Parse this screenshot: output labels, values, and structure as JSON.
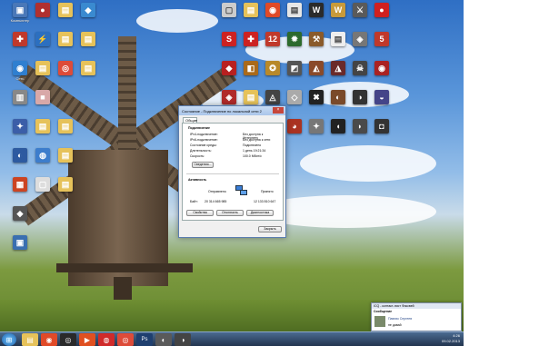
{
  "desktop": {
    "icons": [
      {
        "label": "Компьютер",
        "color": "#4a78b8",
        "glyph": "▣",
        "col": 0,
        "row": 0,
        "icon": "computer-icon"
      },
      {
        "label": "",
        "color": "#b03030",
        "glyph": "●",
        "col": 1,
        "row": 0,
        "icon": "app-icon"
      },
      {
        "label": "",
        "color": "#e6c25a",
        "glyph": "▤",
        "col": 2,
        "row": 0,
        "icon": "folder-icon"
      },
      {
        "label": "",
        "color": "#3a8ad0",
        "glyph": "◆",
        "col": 3,
        "row": 0,
        "icon": "app-icon"
      },
      {
        "label": "",
        "color": "#c0392b",
        "glyph": "✚",
        "col": 0,
        "row": 1,
        "icon": "app-icon"
      },
      {
        "label": "",
        "color": "#2c6fbf",
        "glyph": "⚡",
        "col": 1,
        "row": 1,
        "icon": "app-icon"
      },
      {
        "label": "",
        "color": "#e6c25a",
        "glyph": "▤",
        "col": 2,
        "row": 1,
        "icon": "folder-icon"
      },
      {
        "label": "",
        "color": "#e6c25a",
        "glyph": "▤",
        "col": 3,
        "row": 1,
        "icon": "folder-icon"
      },
      {
        "label": "Сеть",
        "color": "#2f7fd0",
        "glyph": "◉",
        "col": 0,
        "row": 2,
        "icon": "network-icon"
      },
      {
        "label": "",
        "color": "#e6c25a",
        "glyph": "▤",
        "col": 1,
        "row": 2,
        "icon": "folder-icon"
      },
      {
        "label": "",
        "color": "#dd4b39",
        "glyph": "◎",
        "col": 2,
        "row": 2,
        "icon": "chrome-icon"
      },
      {
        "label": "",
        "color": "#e6c25a",
        "glyph": "▤",
        "col": 3,
        "row": 2,
        "icon": "folder-icon"
      },
      {
        "label": "",
        "color": "#888888",
        "glyph": "▥",
        "col": 0,
        "row": 3,
        "icon": "recycle-bin-icon"
      },
      {
        "label": "",
        "color": "#d8a8a8",
        "glyph": "■",
        "col": 1,
        "row": 3,
        "icon": "file-icon"
      },
      {
        "label": "",
        "color": "#3b5ea8",
        "glyph": "✦",
        "col": 0,
        "row": 4,
        "icon": "app-icon"
      },
      {
        "label": "",
        "color": "#e6c25a",
        "glyph": "▤",
        "col": 1,
        "row": 4,
        "icon": "folder-icon"
      },
      {
        "label": "",
        "color": "#e6c25a",
        "glyph": "▤",
        "col": 2,
        "row": 4,
        "icon": "folder-icon"
      },
      {
        "label": "",
        "color": "#2d5aa0",
        "glyph": "◐",
        "col": 0,
        "row": 5,
        "icon": "app-icon"
      },
      {
        "label": "",
        "color": "#3d7dcc",
        "glyph": "◍",
        "col": 1,
        "row": 5,
        "icon": "app-icon"
      },
      {
        "label": "",
        "color": "#e6c25a",
        "glyph": "▤",
        "col": 2,
        "row": 5,
        "icon": "folder-icon"
      },
      {
        "label": "",
        "color": "#cc4422",
        "glyph": "▦",
        "col": 0,
        "row": 6,
        "icon": "app-icon"
      },
      {
        "label": "",
        "color": "#dddddd",
        "glyph": "▢",
        "col": 1,
        "row": 6,
        "icon": "file-icon"
      },
      {
        "label": "",
        "color": "#e6c25a",
        "glyph": "▤",
        "col": 2,
        "row": 6,
        "icon": "folder-icon"
      },
      {
        "label": "",
        "color": "#555555",
        "glyph": "◆",
        "col": 0,
        "row": 7,
        "icon": "app-icon"
      },
      {
        "label": "",
        "color": "#3a6fb0",
        "glyph": "▣",
        "col": 0,
        "row": 8,
        "icon": "app-icon"
      }
    ],
    "right_icons": [
      {
        "color": "#cccccc",
        "glyph": "▢",
        "icon": "file-icon"
      },
      {
        "color": "#e6c25a",
        "glyph": "▤",
        "icon": "folder-icon"
      },
      {
        "color": "#e04a28",
        "glyph": "◉",
        "icon": "firefox-icon"
      },
      {
        "color": "#e6e6e6",
        "glyph": "▤",
        "icon": "file-icon"
      },
      {
        "color": "#2b2b2b",
        "glyph": "W",
        "icon": "game-icon"
      },
      {
        "color": "#c89a3a",
        "glyph": "W",
        "icon": "game-icon"
      },
      {
        "color": "#5a5a5a",
        "glyph": "⚔",
        "icon": "game-icon"
      },
      {
        "color": "#d02020",
        "glyph": "●",
        "icon": "game-icon"
      },
      {
        "color": "#cc2222",
        "glyph": "S",
        "icon": "game-icon"
      },
      {
        "color": "#cc2222",
        "glyph": "✚",
        "icon": "game-icon"
      },
      {
        "color": "#c0392b",
        "glyph": "12",
        "icon": "game-icon"
      },
      {
        "color": "#2d6a2d",
        "glyph": "✹",
        "icon": "game-icon"
      },
      {
        "color": "#8a5a2a",
        "glyph": "⚒",
        "icon": "game-icon"
      },
      {
        "color": "#eeeeee",
        "glyph": "▤",
        "icon": "file-icon"
      },
      {
        "color": "#777777",
        "glyph": "◈",
        "icon": "game-icon"
      },
      {
        "color": "#c0392b",
        "glyph": "5",
        "icon": "game-icon"
      },
      {
        "color": "#b82020",
        "glyph": "◆",
        "icon": "game-icon"
      },
      {
        "color": "#aa6a1a",
        "glyph": "◧",
        "icon": "game-icon"
      },
      {
        "color": "#b8892a",
        "glyph": "✪",
        "icon": "game-icon"
      },
      {
        "color": "#555555",
        "glyph": "◩",
        "icon": "game-icon"
      },
      {
        "color": "#8a4a2a",
        "glyph": "◭",
        "icon": "game-icon"
      },
      {
        "color": "#6a2a2a",
        "glyph": "◮",
        "icon": "game-icon"
      },
      {
        "color": "#444444",
        "glyph": "☠",
        "icon": "game-icon"
      },
      {
        "color": "#aa2222",
        "glyph": "◉",
        "icon": "game-icon"
      },
      {
        "color": "#b02a2a",
        "glyph": "◈",
        "icon": "game-icon"
      },
      {
        "color": "#e6c25a",
        "glyph": "▤",
        "icon": "folder-icon"
      },
      {
        "color": "#444444",
        "glyph": "◬",
        "icon": "game-icon"
      },
      {
        "color": "#aaaaaa",
        "glyph": "◇",
        "icon": "game-icon"
      },
      {
        "color": "#222222",
        "glyph": "✖",
        "icon": "game-icon"
      },
      {
        "color": "#7a4a2a",
        "glyph": "◐",
        "icon": "game-icon"
      },
      {
        "color": "#333333",
        "glyph": "◑",
        "icon": "game-icon"
      },
      {
        "color": "#444488",
        "glyph": "◒",
        "icon": "game-icon"
      },
      {
        "color": "#ffffff",
        "glyph": "▢",
        "icon": "file-icon"
      },
      {
        "color": "#556b2f",
        "glyph": "◓",
        "icon": "game-icon"
      },
      {
        "color": "#3a3a3a",
        "glyph": "◔",
        "icon": "game-icon"
      },
      {
        "color": "#aa3322",
        "glyph": "◕",
        "icon": "game-icon"
      },
      {
        "color": "#777777",
        "glyph": "✦",
        "icon": "game-icon"
      },
      {
        "color": "#222222",
        "glyph": "◖",
        "icon": "game-icon"
      },
      {
        "color": "#4a4a4a",
        "glyph": "◗",
        "icon": "game-icon"
      },
      {
        "color": "#333333",
        "glyph": "◘",
        "icon": "game-icon"
      }
    ]
  },
  "dialog": {
    "title": "Состояние - Подключение по локальной сети 2",
    "tab_general": "Общие",
    "section_connection": "Подключение",
    "rows": [
      {
        "key": "IPv4-подключение:",
        "value": "Без доступа к Интернету"
      },
      {
        "key": "IPv6-подключение:",
        "value": "Без доступа к сети"
      },
      {
        "key": "Состояние среды:",
        "value": "Подключено"
      },
      {
        "key": "Длительность:",
        "value": "1 день 19:21:34"
      },
      {
        "key": "Скорость:",
        "value": "100.0 Мбит/с"
      }
    ],
    "details_button": "Сведения...",
    "section_activity": "Активность",
    "sent_label": "Отправлено",
    "received_label": "Принято",
    "bytes_label": "Байт:",
    "bytes_sent": "20 314 665 985",
    "bytes_received": "12 133 810 647",
    "properties_button": "Свойства",
    "disable_button": "Отключить",
    "diagnose_button": "Диагностика",
    "close_button": "Закрыть"
  },
  "chat": {
    "header": "ICQ - контакт-лист Фоксвей",
    "title": "Сообщение",
    "sender": "Павлик Сергеев",
    "message": "не давай"
  },
  "taskbar": {
    "start_icon": "windows-start-icon",
    "apps": [
      {
        "icon": "explorer-icon",
        "color": "#e6c25a",
        "glyph": "▤"
      },
      {
        "icon": "firefox-icon",
        "color": "#e04a28",
        "glyph": "◉"
      },
      {
        "icon": "app-icon",
        "color": "#2a2a2a",
        "glyph": "◎"
      },
      {
        "icon": "media-icon",
        "color": "#e05020",
        "glyph": "▶"
      },
      {
        "icon": "app-icon",
        "color": "#d02a2a",
        "glyph": "◍"
      },
      {
        "icon": "chrome-icon",
        "color": "#dd4b39",
        "glyph": "◎"
      },
      {
        "icon": "photoshop-icon",
        "color": "#1f3f6f",
        "glyph": "Ps"
      },
      {
        "icon": "app-icon",
        "color": "#5a5a5a",
        "glyph": "◐"
      },
      {
        "icon": "app-icon",
        "color": "#444444",
        "glyph": "◑"
      }
    ],
    "time": "4:26",
    "date": "09.02.2013"
  }
}
